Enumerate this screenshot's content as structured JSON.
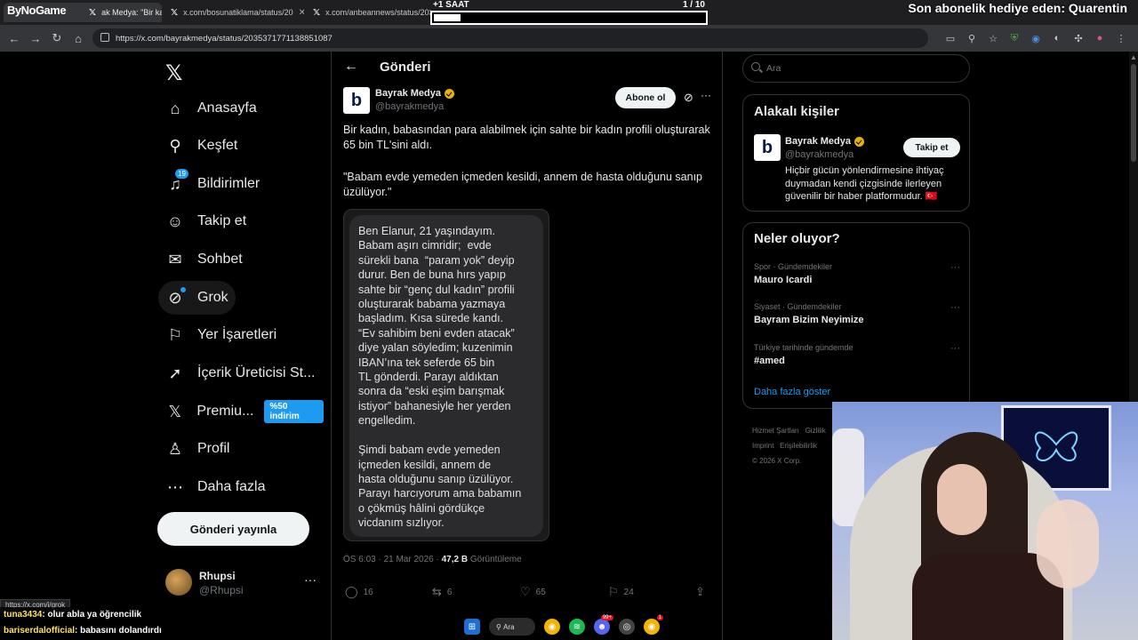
{
  "browser": {
    "brand_overlay": "ByNoGame",
    "tabs": [
      {
        "label": "ak Medya: \"Bir ka"
      },
      {
        "label": "x.com/bosunatiklama/status/20"
      },
      {
        "label": "x.com/anbeannews/status/203"
      }
    ],
    "url": "https://x.com/bayrakmedya/status/2035371771138851087"
  },
  "overlay": {
    "timer_label": "+1 SAAT",
    "timer_count": "1  / 10",
    "timer_progress": 0.1,
    "sub_banner": "Son abonelik hediye eden: Quarentin"
  },
  "nav": {
    "items": [
      {
        "label": "Anasayfa",
        "icon": "home-icon"
      },
      {
        "label": "Keşfet",
        "icon": "search-icon"
      },
      {
        "label": "Bildirimler",
        "icon": "bell-icon",
        "badge": "19"
      },
      {
        "label": "Takip et",
        "icon": "person-add-icon"
      },
      {
        "label": "Sohbet",
        "icon": "mail-icon"
      },
      {
        "label": "Grok",
        "icon": "grok-icon"
      },
      {
        "label": "Yer İşaretleri",
        "icon": "bookmark-icon"
      },
      {
        "label": "İçerik Üreticisi St...",
        "icon": "rocket-icon"
      },
      {
        "label": "Premiu...",
        "icon": "x-icon",
        "promo": "%50 indirim"
      },
      {
        "label": "Profil",
        "icon": "profile-icon"
      },
      {
        "label": "Daha fazla",
        "icon": "more-circle-icon"
      }
    ],
    "post_button": "Gönderi yayınla",
    "profile": {
      "name": "Rhupsi",
      "handle": "@Rhupsi"
    }
  },
  "post": {
    "header_title": "Gönderi",
    "author_name": "Bayrak Medya",
    "author_handle": "@bayrakmedya",
    "subscribe_label": "Abone ol",
    "text1": "Bir kadın, babasından para alabilmek için sahte bir kadın profili oluşturarak 65 bin TL'sini aldı.",
    "text2": "\"Babam evde yemeden içmeden kesildi, annem de hasta olduğunu sanıp üzülüyor.\"",
    "image_text": "Ben Elanur, 21 yaşındayım.\nBabam aşırı cimridir;  evde\nsürekli bana  “param yok” deyip\ndurur. Ben de buna hırs yapıp\nsahte bir “genç dul kadın” profili\noluşturarak babama yazmaya\nbaşladım. Kısa sürede kandı.\n“Ev sahibim beni evden atacak”\ndiye yalan söyledim; kuzenimin\nIBAN’ına tek seferde 65 bin\nTL gönderdi. Parayı aldıktan\nsonra da “eski eşim barışmak\nistiyor” bahanesiyle her yerden\nengelledim.\n\nŞimdi babam evde yemeden\niçmeden kesildi, annem de\nhasta olduğunu sanıp üzülüyor.\nParayı harcıyorum ama babamın\no çökmüş hâlini gördükçe\nvicdanım sızlıyor.",
    "time": "ÖS 6:03 · 21 Mar 2026 · ",
    "views": "47,2 B",
    "views_label": " Görüntüleme",
    "replies": "16",
    "reposts": "6",
    "likes": "65",
    "bookmarks": "24"
  },
  "right": {
    "search_placeholder": "Ara",
    "related_title": "Alakalı kişiler",
    "related": {
      "name": "Bayrak Medya",
      "handle": "@bayrakmedya",
      "bio": "Hiçbir gücün yönlendirmesine ihtiyaç duymadan kendi çizgisinde ilerleyen güvenilir bir haber platformudur. 🇹🇷",
      "follow_label": "Takip et"
    },
    "trends_title": "Neler oluyor?",
    "trends": [
      {
        "category": "Spor · Gündemdekiler",
        "title": "Mauro Icardi"
      },
      {
        "category": "Siyaset · Gündemdekiler",
        "title": "Bayram Bizim Neyimize"
      },
      {
        "category": "Türkiye tarihinde gündemde",
        "title": "#amed"
      }
    ],
    "show_more": "Daha fazla göster",
    "footer": [
      "Hizmet Şartları",
      "Gizlilik",
      "Imprint",
      "Erişilebilirlik",
      "© 2026 X Corp."
    ]
  },
  "chat": [
    {
      "user": "tuna3434",
      "message": " : olur abla ya öğrencilik"
    },
    {
      "user": "bariserdalofficial",
      "message": " : babasını dolandırdı"
    }
  ],
  "status_url": "https://x.com/i/grok",
  "taskbar": {
    "search_label": "Ara",
    "badges": [
      "99+",
      "1"
    ]
  }
}
